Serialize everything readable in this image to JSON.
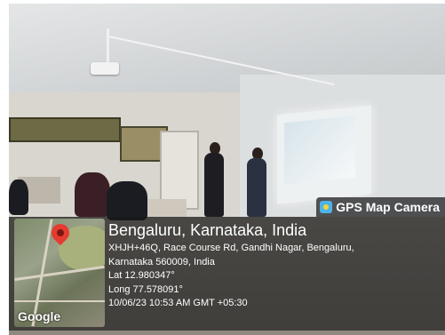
{
  "badge": {
    "label": "GPS Map Camera",
    "icon": "gps-map-camera-icon"
  },
  "map": {
    "watermark": "Google",
    "pin_icon": "location-pin-icon"
  },
  "location": {
    "title": "Bengaluru, Karnataka, India",
    "address_line_1": "XHJH+46Q, Race Course Rd, Gandhi Nagar, Bengaluru,",
    "address_line_2": "Karnataka 560009, India",
    "latitude": "Lat 12.980347°",
    "longitude": "Long 77.578091°",
    "datetime": "10/06/23 10:53 AM GMT +05:30"
  }
}
